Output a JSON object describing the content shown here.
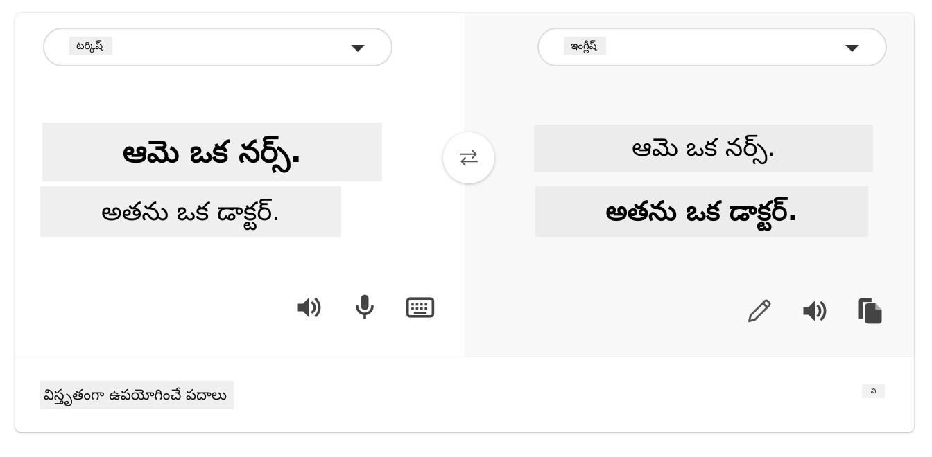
{
  "source": {
    "language": "టర్కిష్",
    "lines": [
      "ఆమె ఒక నర్స్.",
      "అతను ఒక డాక్టర్."
    ],
    "icons": [
      "speaker-icon",
      "microphone-icon",
      "keyboard-icon"
    ]
  },
  "target": {
    "language": "ఇంగ్లీష్",
    "lines": [
      "ఆమె ఒక నర్స్.",
      "అతను ఒక డాక్టర్."
    ],
    "icons": [
      "pencil-icon",
      "speaker-icon",
      "copy-icon"
    ]
  },
  "swap": {
    "icon": "swap-arrows-icon"
  },
  "footer": {
    "label": "విస్తృతంగా ఉపయోగించే పదాలు",
    "more": "వి"
  },
  "colors": {
    "icon": "#444444",
    "highlight": "#efefef",
    "target_background": "#f8f8f8"
  }
}
